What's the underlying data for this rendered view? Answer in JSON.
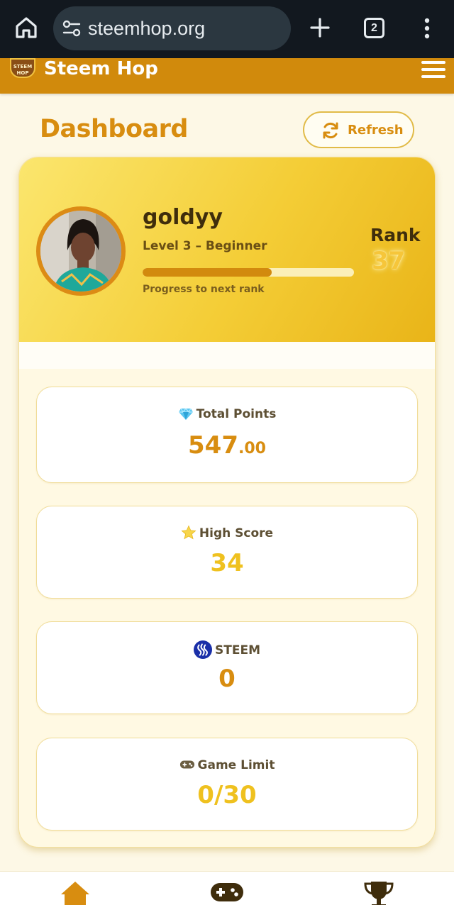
{
  "browser": {
    "url": "steemhop.org",
    "tab_count": "2",
    "icons": [
      "home-icon",
      "site-settings-icon",
      "new-tab-icon",
      "tabs-icon",
      "more-menu-icon"
    ]
  },
  "header": {
    "brand": "Steem Hop",
    "logo_text": "STEEM HOP",
    "accent_color": "#d18a0c",
    "icons": [
      "logo",
      "hamburger-menu-icon"
    ]
  },
  "dashboard": {
    "title": "Dashboard",
    "refresh_label": "Refresh"
  },
  "profile": {
    "username": "goldyy",
    "level": "Level 3 – Beginner",
    "progress_caption": "Progress to next rank",
    "progress_fraction": 0.61,
    "rank_label": "Rank",
    "rank_value": "37"
  },
  "stats": {
    "total_points": {
      "label": "Total Points",
      "whole": "547",
      "decimal": ".00",
      "icon": "gem-icon"
    },
    "high_score": {
      "label": "High Score",
      "value": "34",
      "icon": "star-icon"
    },
    "steem": {
      "label": "STEEM",
      "value": "0",
      "icon": "steem-logo-icon"
    },
    "game_limit": {
      "label": "Game Limit",
      "value": "0/30",
      "icon": "gamepad-icon"
    }
  },
  "bottom_nav": {
    "items": [
      "home-icon",
      "gamepad-icon",
      "trophy-icon"
    ]
  }
}
